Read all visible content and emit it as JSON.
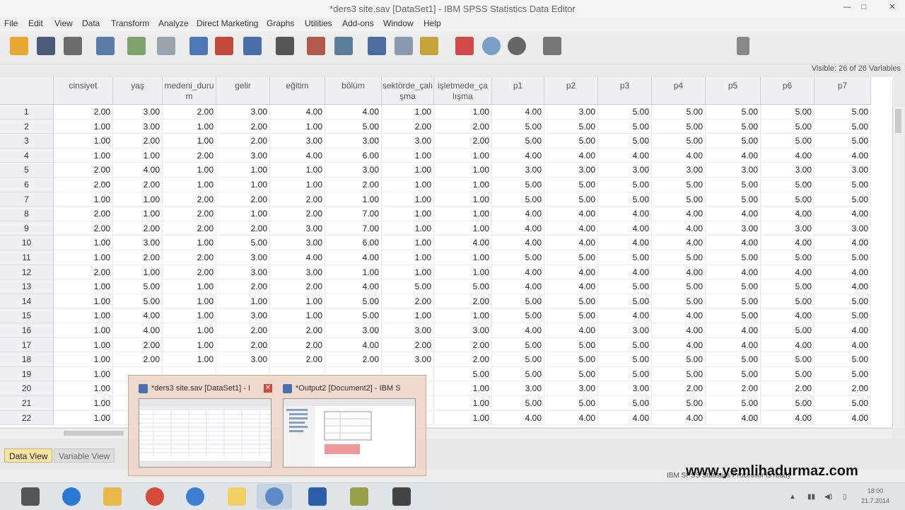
{
  "window": {
    "title": "*ders3 site.sav [DataSet1] - IBM SPSS Statistics Data Editor",
    "minimize": "—",
    "maximize": "□",
    "close": "✕"
  },
  "menu": [
    "File",
    "Edit",
    "View",
    "Data",
    "Transform",
    "Analyze",
    "Direct Marketing",
    "Graphs",
    "Utilities",
    "Add-ons",
    "Window",
    "Help"
  ],
  "toolbar": {
    "icons": [
      "open-icon",
      "save-icon",
      "print-icon",
      "dialog-recall-icon",
      "undo-icon",
      "redo-icon",
      "goto-case-icon",
      "goto-variable-icon",
      "variables-icon",
      "find-icon",
      "insert-cases-icon",
      "insert-variable-icon",
      "split-file-icon",
      "weight-cases-icon",
      "select-cases-icon",
      "value-labels-icon",
      "use-sets-icon",
      "show-sets-icon",
      "spelling-icon",
      "scripting-icon"
    ]
  },
  "info": {
    "visible": "Visible: 26 of 26 Variables"
  },
  "columns": [
    "cinsiyet",
    "yaş",
    "medeni_duru m",
    "gelir",
    "eğitim",
    "bölüm",
    "sektörde_çalı şma",
    "işletmede_ça lışma",
    "p1",
    "p2",
    "p3",
    "p4",
    "p5",
    "p6",
    "p7"
  ],
  "rows": [
    {
      "n": "1",
      "v": [
        "2.00",
        "3.00",
        "2.00",
        "3.00",
        "4.00",
        "4.00",
        "1.00",
        "1.00",
        "4.00",
        "3.00",
        "5.00",
        "5.00",
        "5.00",
        "5.00",
        "5.00"
      ]
    },
    {
      "n": "2",
      "v": [
        "1.00",
        "3.00",
        "1.00",
        "2.00",
        "1.00",
        "5.00",
        "2.00",
        "2.00",
        "5.00",
        "5.00",
        "5.00",
        "5.00",
        "5.00",
        "5.00",
        "5.00"
      ]
    },
    {
      "n": "3",
      "v": [
        "1.00",
        "2.00",
        "1.00",
        "2.00",
        "3.00",
        "3.00",
        "3.00",
        "2.00",
        "5.00",
        "5.00",
        "5.00",
        "5.00",
        "5.00",
        "5.00",
        "5.00"
      ]
    },
    {
      "n": "4",
      "v": [
        "1.00",
        "1.00",
        "2.00",
        "3.00",
        "4.00",
        "6.00",
        "1.00",
        "1.00",
        "4.00",
        "4.00",
        "4.00",
        "4.00",
        "4.00",
        "4.00",
        "4.00"
      ]
    },
    {
      "n": "5",
      "v": [
        "2.00",
        "4.00",
        "1.00",
        "1.00",
        "1.00",
        "3.00",
        "1.00",
        "1.00",
        "3.00",
        "3.00",
        "3.00",
        "3.00",
        "3.00",
        "3.00",
        "3.00"
      ]
    },
    {
      "n": "6",
      "v": [
        "2.00",
        "2.00",
        "1.00",
        "1.00",
        "1.00",
        "2.00",
        "1.00",
        "1.00",
        "5.00",
        "5.00",
        "5.00",
        "5.00",
        "5.00",
        "5.00",
        "5.00"
      ]
    },
    {
      "n": "7",
      "v": [
        "1.00",
        "1.00",
        "2.00",
        "2.00",
        "2.00",
        "1.00",
        "1.00",
        "1.00",
        "5.00",
        "5.00",
        "5.00",
        "5.00",
        "5.00",
        "5.00",
        "5.00"
      ]
    },
    {
      "n": "8",
      "v": [
        "2.00",
        "1.00",
        "2.00",
        "1.00",
        "2.00",
        "7.00",
        "1.00",
        "1.00",
        "4.00",
        "4.00",
        "4.00",
        "4.00",
        "4.00",
        "4.00",
        "4.00"
      ]
    },
    {
      "n": "9",
      "v": [
        "2.00",
        "2.00",
        "2.00",
        "2.00",
        "3.00",
        "7.00",
        "1.00",
        "1.00",
        "4.00",
        "4.00",
        "4.00",
        "4.00",
        "3.00",
        "3.00",
        "3.00"
      ]
    },
    {
      "n": "10",
      "v": [
        "1.00",
        "3.00",
        "1.00",
        "5.00",
        "3.00",
        "6.00",
        "1.00",
        "4.00",
        "4.00",
        "4.00",
        "4.00",
        "4.00",
        "4.00",
        "4.00",
        "4.00"
      ]
    },
    {
      "n": "11",
      "v": [
        "1.00",
        "2.00",
        "2.00",
        "3.00",
        "4.00",
        "4.00",
        "1.00",
        "1.00",
        "5.00",
        "5.00",
        "5.00",
        "5.00",
        "5.00",
        "5.00",
        "5.00"
      ]
    },
    {
      "n": "12",
      "v": [
        "2.00",
        "1.00",
        "2.00",
        "3.00",
        "3.00",
        "1.00",
        "1.00",
        "1.00",
        "4.00",
        "4.00",
        "4.00",
        "4.00",
        "4.00",
        "4.00",
        "4.00"
      ]
    },
    {
      "n": "13",
      "v": [
        "1.00",
        "5.00",
        "1.00",
        "2.00",
        "2.00",
        "4.00",
        "5.00",
        "5.00",
        "4.00",
        "4.00",
        "5.00",
        "5.00",
        "5.00",
        "5.00",
        "4.00"
      ]
    },
    {
      "n": "14",
      "v": [
        "1.00",
        "5.00",
        "1.00",
        "1.00",
        "1.00",
        "5.00",
        "2.00",
        "2.00",
        "5.00",
        "5.00",
        "5.00",
        "5.00",
        "5.00",
        "5.00",
        "5.00"
      ]
    },
    {
      "n": "15",
      "v": [
        "1.00",
        "4.00",
        "1.00",
        "3.00",
        "1.00",
        "5.00",
        "1.00",
        "1.00",
        "5.00",
        "5.00",
        "4.00",
        "4.00",
        "5.00",
        "4.00",
        "5.00"
      ]
    },
    {
      "n": "16",
      "v": [
        "1.00",
        "4.00",
        "1.00",
        "2.00",
        "2.00",
        "3.00",
        "3.00",
        "3.00",
        "4.00",
        "4.00",
        "3.00",
        "4.00",
        "4.00",
        "5.00",
        "4.00"
      ]
    },
    {
      "n": "17",
      "v": [
        "1.00",
        "2.00",
        "1.00",
        "2.00",
        "2.00",
        "4.00",
        "2.00",
        "2.00",
        "5.00",
        "5.00",
        "5.00",
        "4.00",
        "4.00",
        "4.00",
        "4.00"
      ]
    },
    {
      "n": "18",
      "v": [
        "1.00",
        "2.00",
        "1.00",
        "3.00",
        "2.00",
        "2.00",
        "3.00",
        "2.00",
        "5.00",
        "5.00",
        "5.00",
        "5.00",
        "5.00",
        "5.00",
        "5.00"
      ]
    },
    {
      "n": "19",
      "v": [
        "1.00",
        "",
        "",
        "",
        "",
        "",
        "",
        "5.00",
        "5.00",
        "5.00",
        "5.00",
        "5.00",
        "5.00",
        "5.00",
        "5.00"
      ]
    },
    {
      "n": "20",
      "v": [
        "1.00",
        "",
        "",
        "",
        "",
        "",
        "",
        "1.00",
        "3.00",
        "3.00",
        "3.00",
        "2.00",
        "2.00",
        "2.00",
        "2.00"
      ]
    },
    {
      "n": "21",
      "v": [
        "1.00",
        "",
        "",
        "",
        "",
        "",
        "",
        "1.00",
        "5.00",
        "5.00",
        "5.00",
        "5.00",
        "5.00",
        "5.00",
        "5.00"
      ]
    },
    {
      "n": "22",
      "v": [
        "1.00",
        "",
        "",
        "",
        "",
        "",
        "",
        "1.00",
        "4.00",
        "4.00",
        "4.00",
        "4.00",
        "4.00",
        "4.00",
        "4.00"
      ]
    }
  ],
  "tabs": {
    "data_view": "Data View",
    "variable_view": "Variable View"
  },
  "status": {
    "message": "IBM SPSS Statistics Processor is ready"
  },
  "watermark": "www.yemlihadurmaz.com",
  "taskbar": {
    "apps": [
      "windows-icon",
      "ie-icon",
      "explorer-icon",
      "chrome-icon",
      "photoshop-icon",
      "folder-icon",
      "spss-icon",
      "word-icon",
      "notes-icon",
      "media-icon"
    ],
    "time": "18:00",
    "date": "21.7.2014"
  },
  "thumbnails": [
    {
      "title": "*ders3 site.sav [DataSet1] - I"
    },
    {
      "title": "*Output2 [Document2] - IBM S"
    }
  ],
  "colors": {
    "grid_header": "#eef0f4",
    "preview_bg": "#eed6c8"
  }
}
